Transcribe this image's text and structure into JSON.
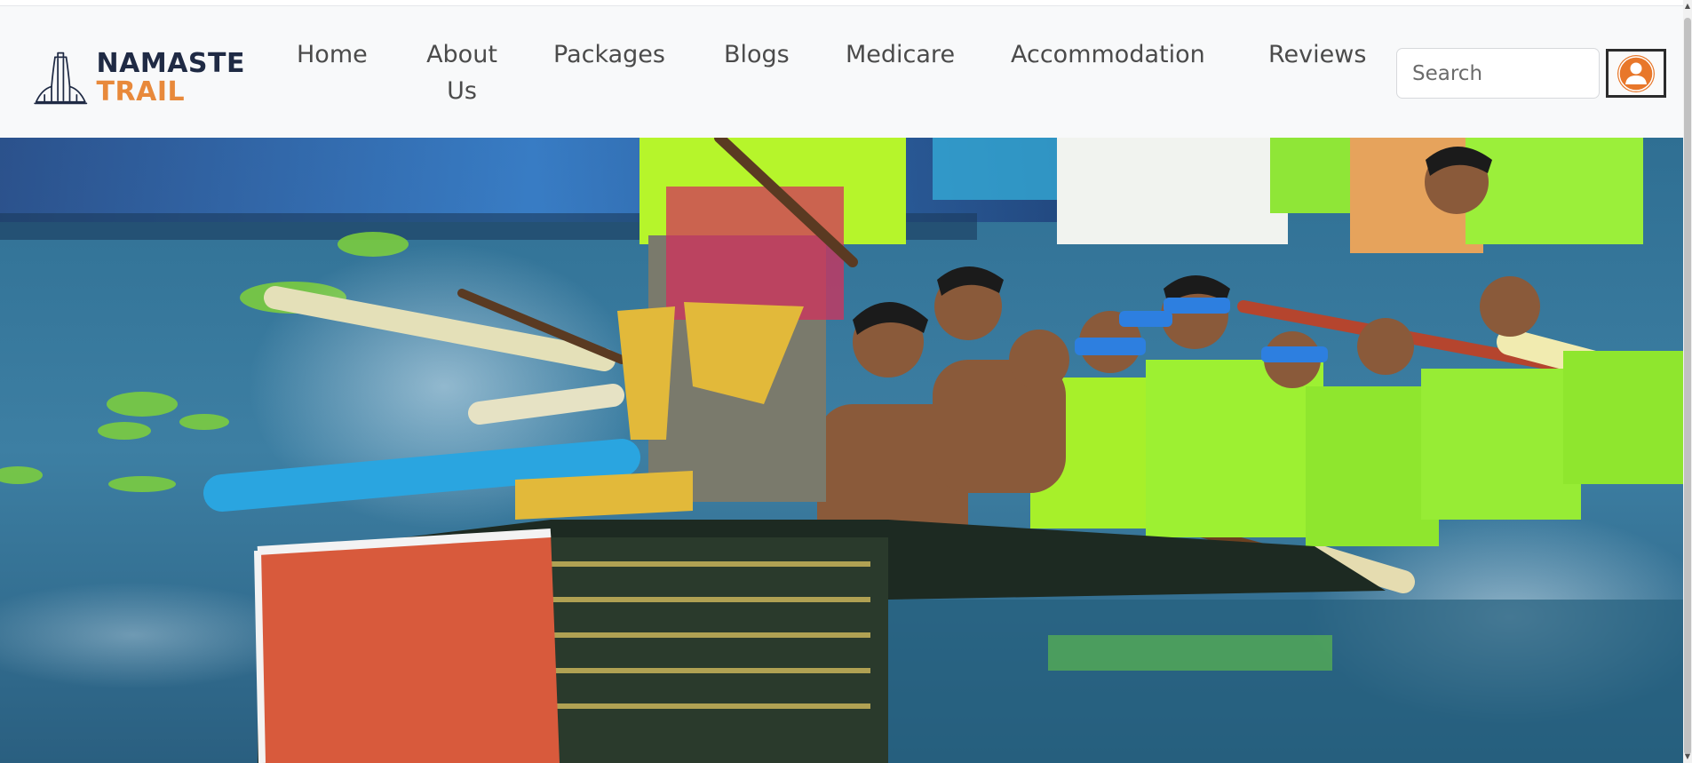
{
  "brand": {
    "line1": "NAMASTE",
    "line2": "TRAIL",
    "logo_icon": "folded-hands-temple-icon",
    "colors": {
      "dark": "#1f2a44",
      "accent": "#e8893b"
    }
  },
  "nav": {
    "items": [
      {
        "label": "Home"
      },
      {
        "label": "About Us"
      },
      {
        "label": "Packages"
      },
      {
        "label": "Blogs"
      },
      {
        "label": "Medicare"
      },
      {
        "label": "Accommodation"
      },
      {
        "label": "Reviews"
      }
    ]
  },
  "search": {
    "placeholder": "Search"
  },
  "profile": {
    "icon": "user-avatar-icon",
    "color": "#e8772a"
  },
  "hero": {
    "image": "snake-boat-race-photo"
  }
}
